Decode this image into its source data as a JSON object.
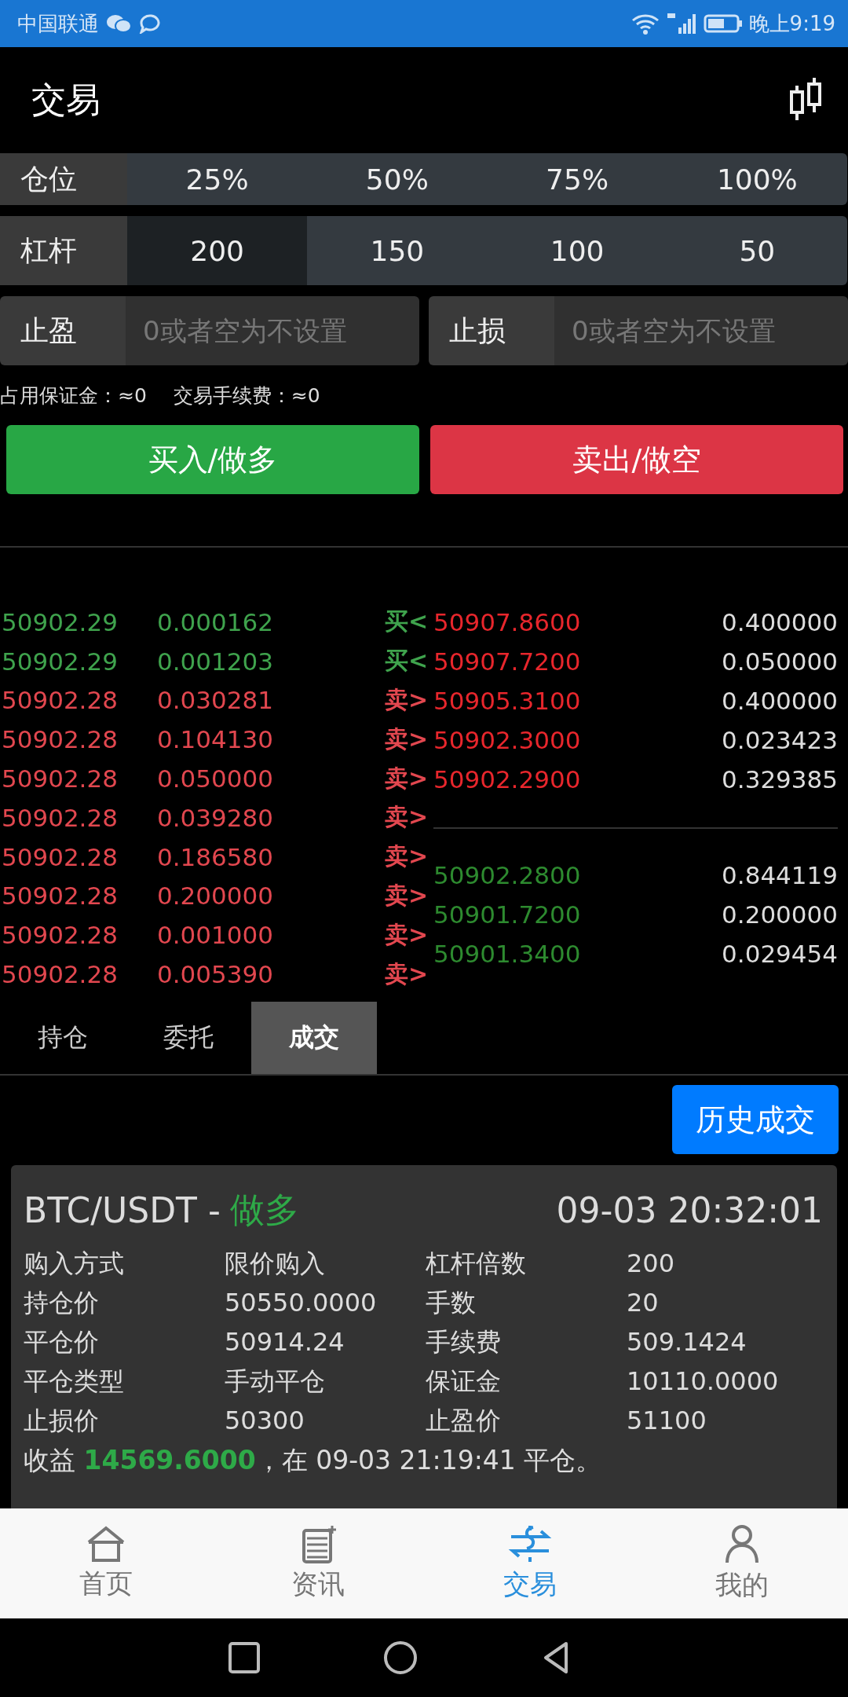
{
  "status_bar": {
    "carrier": "中国联通",
    "time": "晚上9:19"
  },
  "header": {
    "title": "交易"
  },
  "position": {
    "label": "仓位",
    "options": [
      "25%",
      "50%",
      "75%",
      "100%"
    ]
  },
  "leverage": {
    "label": "杠杆",
    "options": [
      {
        "label": "200",
        "selected": true
      },
      {
        "label": "150",
        "selected": false
      },
      {
        "label": "100",
        "selected": false
      },
      {
        "label": "50",
        "selected": false
      }
    ]
  },
  "stop_fields": [
    {
      "label": "止盈",
      "placeholder": "0或者空为不设置"
    },
    {
      "label": "止损",
      "placeholder": "0或者空为不设置"
    }
  ],
  "info": [
    "占用保证金：≈0",
    "交易手续费：≈0"
  ],
  "actions": [
    {
      "label": "买入/做多",
      "kind": "buy"
    },
    {
      "label": "卖出/做空",
      "kind": "sell"
    }
  ],
  "trades": [
    {
      "price": "50902.29",
      "amount": "0.000162",
      "kind": "buy",
      "marker": "买<"
    },
    {
      "price": "50902.29",
      "amount": "0.001203",
      "kind": "buy",
      "marker": "买<"
    },
    {
      "price": "50902.28",
      "amount": "0.030281",
      "kind": "sell",
      "marker": "卖>"
    },
    {
      "price": "50902.28",
      "amount": "0.104130",
      "kind": "sell",
      "marker": "卖>"
    },
    {
      "price": "50902.28",
      "amount": "0.050000",
      "kind": "sell",
      "marker": "卖>"
    },
    {
      "price": "50902.28",
      "amount": "0.039280",
      "kind": "sell",
      "marker": "卖>"
    },
    {
      "price": "50902.28",
      "amount": "0.186580",
      "kind": "sell",
      "marker": "卖>"
    },
    {
      "price": "50902.28",
      "amount": "0.200000",
      "kind": "sell",
      "marker": "卖>"
    },
    {
      "price": "50902.28",
      "amount": "0.001000",
      "kind": "sell",
      "marker": "卖>"
    },
    {
      "price": "50902.28",
      "amount": "0.005390",
      "kind": "sell",
      "marker": "卖>"
    }
  ],
  "asks": [
    {
      "price": "50907.8600",
      "amount": "0.400000"
    },
    {
      "price": "50907.7200",
      "amount": "0.050000"
    },
    {
      "price": "50905.3100",
      "amount": "0.400000"
    },
    {
      "price": "50902.3000",
      "amount": "0.023423"
    },
    {
      "price": "50902.2900",
      "amount": "0.329385"
    }
  ],
  "bids": [
    {
      "price": "50902.2800",
      "amount": "0.844119"
    },
    {
      "price": "50901.7200",
      "amount": "0.200000"
    },
    {
      "price": "50901.3400",
      "amount": "0.029454"
    }
  ],
  "tabs": [
    {
      "label": "持仓",
      "selected": false
    },
    {
      "label": "委托",
      "selected": false
    },
    {
      "label": "成交",
      "selected": true
    }
  ],
  "history_button": "历史成交",
  "card": {
    "pair": "BTC/USDT -",
    "direction": "做多",
    "time": "09-03 20:32:01",
    "fields": [
      {
        "label": "购入方式",
        "value": "限价购入"
      },
      {
        "label": "杠杆倍数",
        "value": "200"
      },
      {
        "label": "持仓价",
        "value": "50550.0000"
      },
      {
        "label": "手数",
        "value": "20"
      },
      {
        "label": "平仓价",
        "value": "50914.24"
      },
      {
        "label": "手续费",
        "value": "509.1424"
      },
      {
        "label": "平仓类型",
        "value": "手动平仓"
      },
      {
        "label": "保证金",
        "value": "10110.0000"
      },
      {
        "label": "止损价",
        "value": "50300"
      },
      {
        "label": "止盈价",
        "value": "51100"
      }
    ],
    "profit": "收益 **14569.6000**，在 09-03 21:19:41 平仓。"
  },
  "nav": [
    {
      "label": "首页",
      "kind": "home",
      "selected": false
    },
    {
      "label": "资讯",
      "kind": "news",
      "selected": false
    },
    {
      "label": "交易",
      "kind": "trade",
      "selected": true
    },
    {
      "label": "我的",
      "kind": "me",
      "selected": false
    }
  ]
}
